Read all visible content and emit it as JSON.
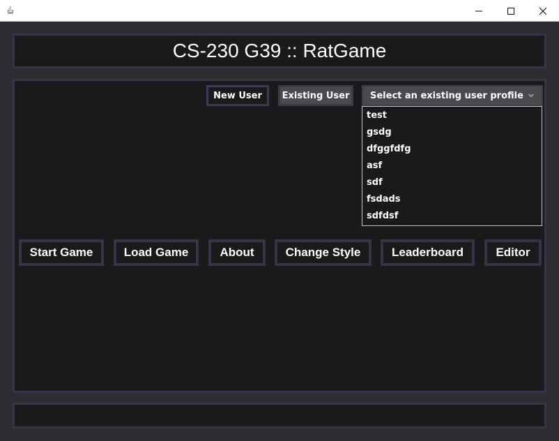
{
  "window": {
    "minimize_icon": "minimize-icon",
    "maximize_icon": "maximize-icon",
    "close_icon": "close-icon"
  },
  "header": {
    "title": "CS-230 G39 :: RatGame"
  },
  "user_controls": {
    "new_user_label": "New User",
    "existing_user_label": "Existing User",
    "profile_select": {
      "selected_text": "Select an existing user profile",
      "options": [
        "test",
        "gsdg",
        "dfggfdfg",
        "asf",
        "sdf",
        "fsdads",
        "sdfdsf"
      ]
    }
  },
  "menu": {
    "start_game": "Start Game",
    "load_game": "Load Game",
    "about": "About",
    "change_style": "Change Style",
    "leaderboard": "Leaderboard",
    "editor": "Editor"
  },
  "colors": {
    "panel_bg": "#1a1a1d",
    "panel_border": "#35354a",
    "app_bg": "#2d2d32",
    "text": "#ffffff"
  }
}
